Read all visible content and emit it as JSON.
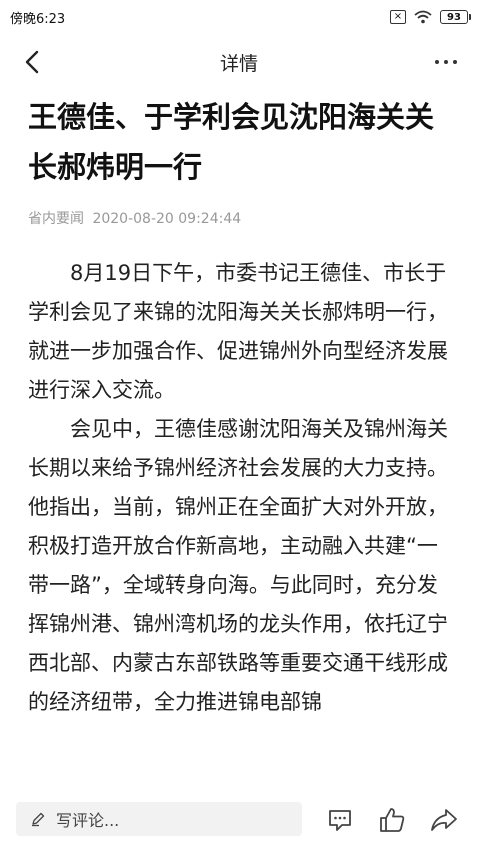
{
  "status_bar": {
    "time": "傍晚6:23",
    "battery": "93"
  },
  "nav": {
    "title": "详情"
  },
  "article": {
    "title": "王德佳、于学利会见沈阳海关关长郝炜明一行",
    "source": "省内要闻",
    "date": "2020-08-20 09:24:44",
    "paragraphs": [
      "8月19日下午，市委书记王德佳、市长于学利会见了来锦的沈阳海关关长郝炜明一行，就进一步加强合作、促进锦州外向型经济发展进行深入交流。",
      "会见中，王德佳感谢沈阳海关及锦州海关长期以来给予锦州经济社会发展的大力支持。他指出，当前，锦州正在全面扩大对外开放，积极打造开放合作新高地，主动融入共建“一带一路”，全域转身向海。与此同时，充分发挥锦州港、锦州湾机场的龙头作用，依托辽宁西北部、内蒙古东部铁路等重要交通干线形成的经济纽带，全力推进锦电部锦"
    ]
  },
  "bottom_bar": {
    "comment_placeholder": "写评论..."
  },
  "icons": {
    "back": "chevron-left-icon",
    "more": "more-dots-icon",
    "pencil": "pencil-icon",
    "comment": "comment-icon",
    "like": "thumbs-up-icon",
    "share": "share-icon"
  }
}
